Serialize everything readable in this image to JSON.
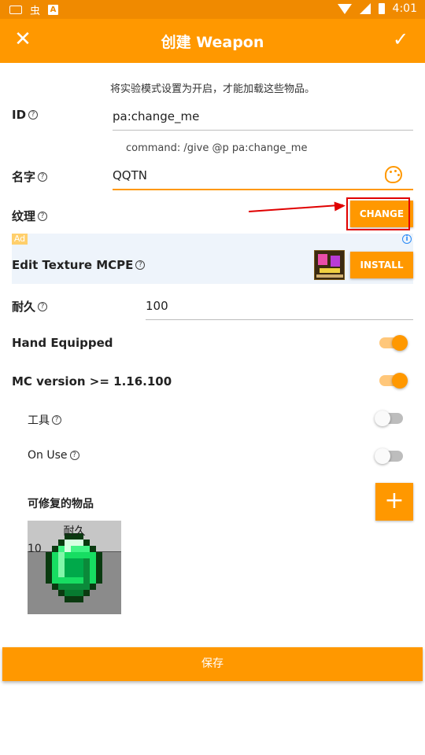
{
  "status_bar": {
    "time": "4:01",
    "bug_glyph": "虫",
    "a_glyph": "A"
  },
  "app_bar": {
    "title": "创建 Weapon",
    "close_icon": "✕",
    "confirm_icon": "✓"
  },
  "notice": "将实验模式设置为开启，才能加载这些物品。",
  "id_field": {
    "label": "ID",
    "value": "pa:change_me",
    "hint": "command: /give @p pa:change_me"
  },
  "name_field": {
    "label": "名字",
    "value": "QQTN"
  },
  "texture": {
    "label": "纹理",
    "button": "CHANGE"
  },
  "ad": {
    "badge": "Ad",
    "title": "Edit Texture MCPE",
    "button": "INSTALL",
    "info_glyph": "i"
  },
  "durability": {
    "label": "耐久",
    "value": "100"
  },
  "toggles": [
    {
      "label": "Hand Equipped",
      "on": true
    },
    {
      "label": "MC version >= 1.16.100",
      "on": true
    },
    {
      "label": "工具",
      "on": false
    },
    {
      "label": "On Use",
      "on": false
    }
  ],
  "repair": {
    "label": "可修复的物品",
    "add_glyph": "+",
    "item_label": "耐久",
    "item_value": "10"
  },
  "save_button": "保存",
  "help_glyph": "?",
  "colors": {
    "accent": "#ff9800",
    "status": "#f08a00",
    "arrow": "#e00000"
  }
}
